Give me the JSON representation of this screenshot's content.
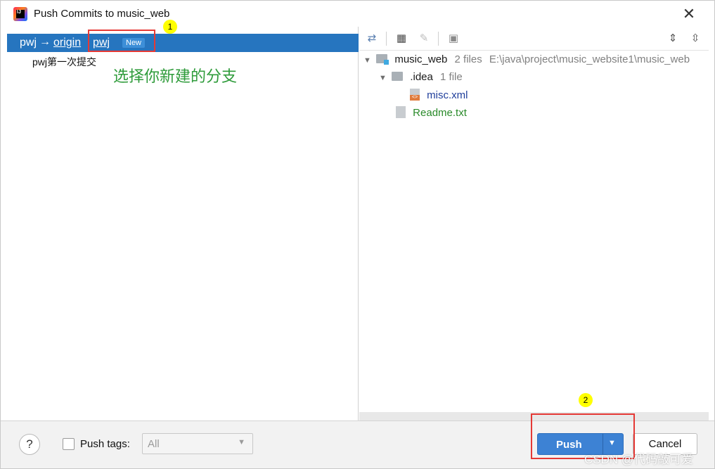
{
  "window": {
    "title": "Push Commits to music_web",
    "close_glyph": "✕",
    "app_icon_text": "IJ"
  },
  "left": {
    "branch": {
      "local": "pwj",
      "arrow": "→",
      "remote": "origin",
      "target": "pwj",
      "badge": "New"
    },
    "commits": [
      "pwj第一次提交"
    ]
  },
  "annotations": {
    "step1": "1",
    "step2": "2",
    "note": "选择你新建的分支"
  },
  "toolbar": {
    "icons": [
      "diff-arrows-icon",
      "group-by-icon",
      "edit-icon",
      "preview-icon",
      "expand-all-icon",
      "collapse-all-icon"
    ]
  },
  "tree": {
    "root": {
      "name": "music_web",
      "count": "2 files",
      "path": "E:\\java\\project\\music_website1\\music_web"
    },
    "idea": {
      "name": ".idea",
      "count": "1 file"
    },
    "misc": {
      "name": "misc.xml"
    },
    "readme": {
      "name": "Readme.txt"
    }
  },
  "bottom": {
    "help": "?",
    "push_tags_label": "Push tags:",
    "push_tags_value": "All",
    "push_label": "Push",
    "cancel_label": "Cancel"
  },
  "watermark": "CSDN @代码敲可爱",
  "colors": {
    "selection": "#2675bf",
    "push_button": "#3d82d4",
    "annotation_red": "#e53935",
    "annotation_green": "#2e9b3a",
    "marker_yellow": "#ffff00"
  }
}
